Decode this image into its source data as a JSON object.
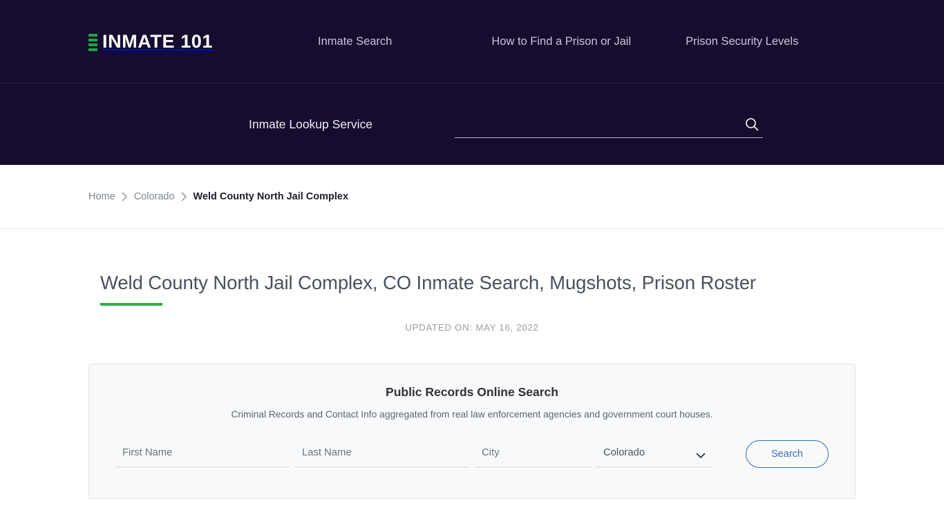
{
  "header": {
    "brand": {
      "name": "INMATE 101",
      "icon": "bars-icon",
      "accent_color": "#24a148"
    },
    "nav": [
      {
        "label": "Inmate Search",
        "name": "nav-inmate-search"
      },
      {
        "label": "How to Find a Prison or Jail",
        "name": "nav-how-to-find"
      },
      {
        "label": "Prison Security Levels",
        "name": "nav-prison-security-levels"
      }
    ],
    "background_color": "#160d2e"
  },
  "search_strip": {
    "label": "Inmate Lookup Service",
    "input_value": "",
    "input_placeholder": "",
    "search_icon": "search-icon"
  },
  "breadcrumb": {
    "items": [
      {
        "label": "Home",
        "current": false
      },
      {
        "label": "Colorado",
        "current": false
      },
      {
        "label": "Weld County North Jail Complex",
        "current": true
      }
    ],
    "separator": "chevron-right-icon"
  },
  "main": {
    "title": "Weld County North Jail Complex, CO Inmate Search, Mugshots, Prison Roster",
    "updated": "UPDATED ON: MAY 16, 2022",
    "accent_color": "#2cab4a"
  },
  "records_card": {
    "title": "Public Records Online Search",
    "subtitle": "Criminal Records and Contact Info aggregated from real law enforcement agencies and government court houses.",
    "fields": {
      "first_name": {
        "placeholder": "First Name",
        "value": ""
      },
      "last_name": {
        "placeholder": "Last Name",
        "value": ""
      },
      "city": {
        "placeholder": "City",
        "value": ""
      },
      "state": {
        "selected": "Colorado",
        "options": [
          "Colorado"
        ]
      }
    },
    "submit_label": "Search",
    "submit_color": "#3b6fb0"
  }
}
